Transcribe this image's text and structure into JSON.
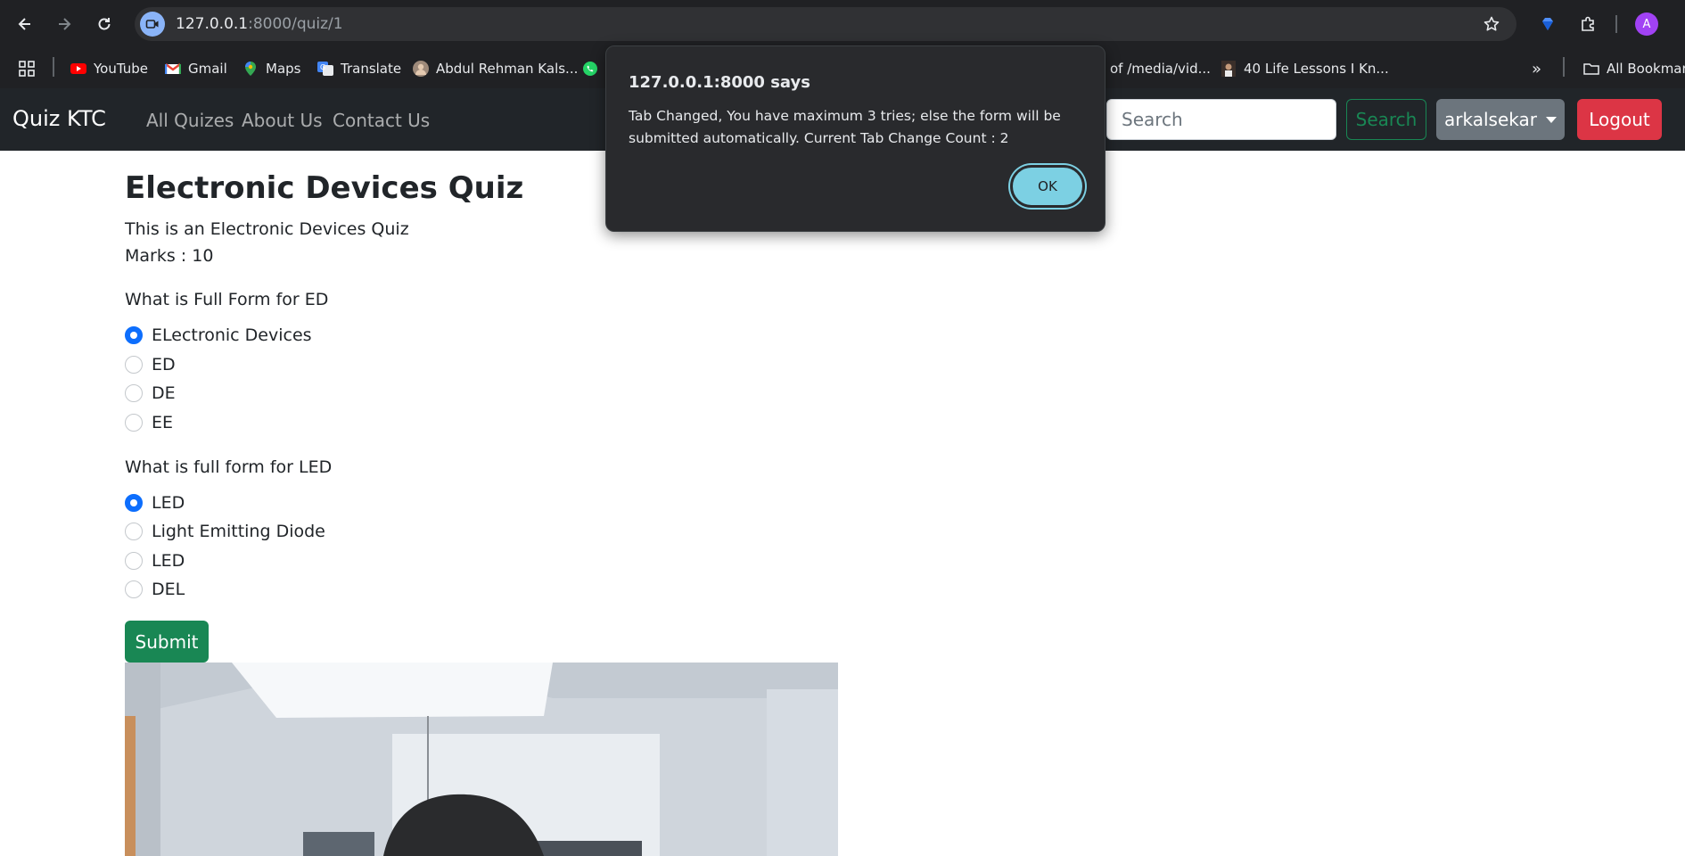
{
  "browser": {
    "url_host": "127.0.0.1",
    "url_rest": ":8000/quiz/1",
    "profile_initial": "A",
    "bookmarks": [
      {
        "label": "YouTube",
        "icon": "youtube-icon"
      },
      {
        "label": "Gmail",
        "icon": "gmail-icon"
      },
      {
        "label": "Maps",
        "icon": "maps-icon"
      },
      {
        "label": "Translate",
        "icon": "translate-icon"
      },
      {
        "label": "Abdul Rehman Kals...",
        "icon": "avatar-icon"
      },
      {
        "label": "",
        "icon": "whatsapp-icon"
      },
      {
        "label": "of /media/vid...",
        "icon": ""
      },
      {
        "label": "40 Life Lessons I Kn...",
        "icon": "thumbnail-icon"
      }
    ],
    "bookmarks_overflow": "»",
    "all_bookmarks_label": "All Bookmarks"
  },
  "navbar": {
    "brand": "Quiz KTC",
    "links": [
      "All Quizes",
      "About Us",
      "Contact Us"
    ],
    "search_placeholder": "Search",
    "search_button": "Search",
    "user_label": "arkalsekar",
    "logout_label": "Logout"
  },
  "quiz": {
    "title": "Electronic Devices Quiz",
    "description": "This is an Electronic Devices Quiz",
    "marks": "Marks : 10",
    "questions": [
      {
        "text": "What is Full Form for ED",
        "options": [
          "ELectronic Devices",
          "ED",
          "DE",
          "EE"
        ],
        "selected": 0
      },
      {
        "text": "What is full form for LED",
        "options": [
          "LED",
          "Light Emitting Diode",
          "LED",
          "DEL"
        ],
        "selected": 0
      }
    ],
    "submit_label": "Submit"
  },
  "dialog": {
    "title": "127.0.0.1:8000 says",
    "message": "Tab Changed, You have maximum 3 tries; else the form will be submitted automatically. Current Tab Change Count : 2",
    "ok_label": "OK"
  },
  "colors": {
    "navbar_bg": "#212529",
    "primary": "#0d6efd",
    "success": "#198754",
    "danger": "#dc3545",
    "secondary": "#6c757d",
    "dialog_bg": "#292a2d",
    "dialog_button": "#7cd0e3"
  }
}
